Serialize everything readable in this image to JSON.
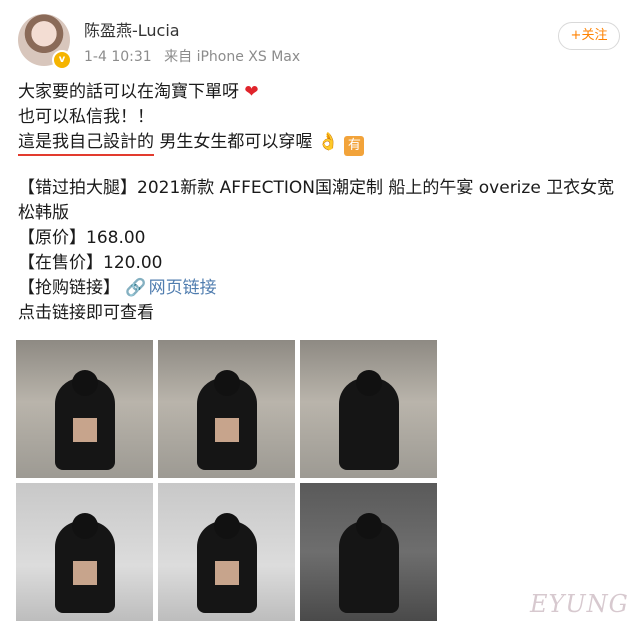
{
  "author": {
    "name": "陈盈燕-Lucia",
    "time": "1-4 10:31",
    "source": "来自 iPhone XS Max",
    "follow_label": "+关注"
  },
  "post": {
    "line1": "大家要的話可以在淘寶下單呀",
    "line2": "也可以私信我！！",
    "line3_underlined": "這是我自己設計的",
    "line3_rest": "男生女生都可以穿喔",
    "emoji_box": "有",
    "product_title": "【错过拍大腿】2021新款 AFFECTION国潮定制 船上的午宴 overize 卫衣女宽松韩版",
    "original_price": "【原价】168.00",
    "sale_price": "【在售价】120.00",
    "purchase_label": "【抢购链接】",
    "link_text": "网页链接",
    "click_hint": "点击链接即可查看"
  },
  "photos": [
    "outdoor",
    "outdoor",
    "outdoor",
    "studio",
    "studio",
    "dark"
  ],
  "watermark": "EYUNG"
}
